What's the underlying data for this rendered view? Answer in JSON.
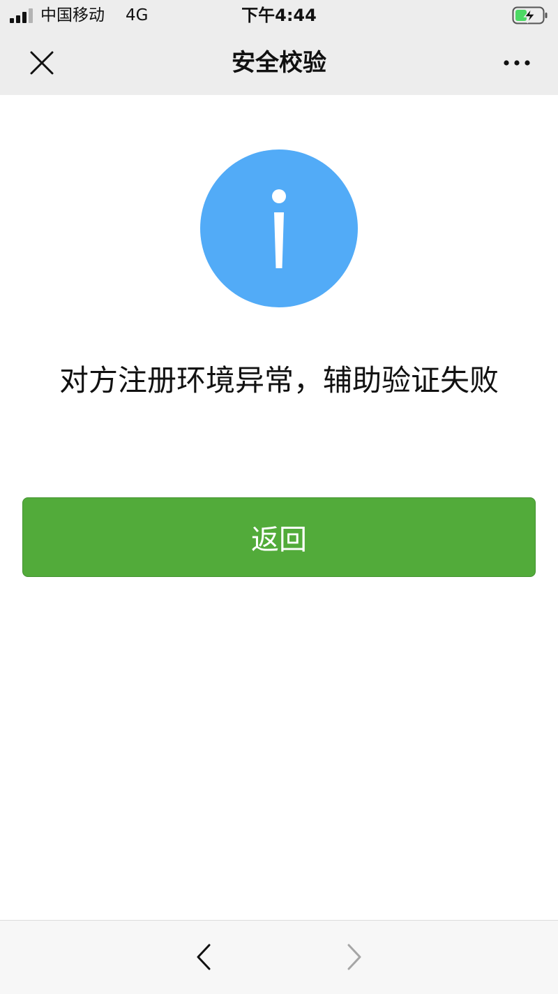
{
  "status_bar": {
    "carrier": "中国移动",
    "network": "4G",
    "time": "下午4:44",
    "icons": [
      "signal-icon",
      "battery-charging-icon"
    ]
  },
  "nav": {
    "title": "安全校验",
    "icons": [
      "close-icon",
      "more-icon"
    ]
  },
  "content": {
    "icon": "info-icon",
    "message": "对方注册环境异常，辅助验证失败",
    "button_label": "返回"
  },
  "bottom_bar": {
    "icons": [
      "back-arrow-icon",
      "forward-arrow-icon"
    ]
  },
  "colors": {
    "info_blue": "#52abf7",
    "button_green": "#52ab3a",
    "battery_green": "#4cd964",
    "header_bg": "#ededed"
  }
}
